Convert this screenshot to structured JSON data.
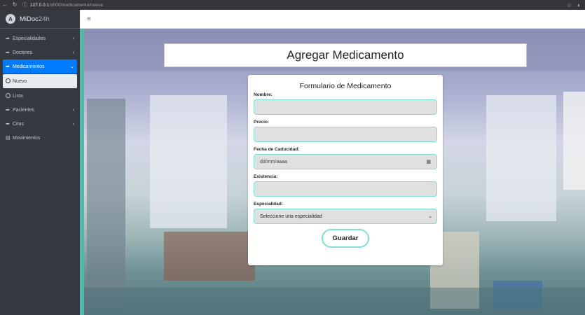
{
  "browser": {
    "url_host": "127.0.0.1",
    "url_path": ":8000/medicamento/nueva"
  },
  "sidebar": {
    "brand": {
      "part1": "MiDoc",
      "part2": "24h"
    },
    "items": [
      {
        "label": "Especialidades",
        "icon": "share-icon"
      },
      {
        "label": "Doctores",
        "icon": "share-icon"
      },
      {
        "label": "Medicamentos",
        "icon": "share-icon"
      },
      {
        "label": "Nuevo",
        "icon": "circle-icon"
      },
      {
        "label": "Lista",
        "icon": "circle-icon"
      },
      {
        "label": "Pacientes",
        "icon": "share-icon"
      },
      {
        "label": "Citas",
        "icon": "share-icon"
      },
      {
        "label": "Movimientos",
        "icon": "document-icon"
      }
    ]
  },
  "main": {
    "title": "Agregar Medicamento",
    "form": {
      "title": "Formulario de Medicamento",
      "fields": [
        {
          "label": "Nombre:",
          "value": ""
        },
        {
          "label": "Precio:",
          "value": ""
        },
        {
          "label": "Fecha de Caducidad:",
          "placeholder": "dd/mm/aaaa"
        },
        {
          "label": "Existencia:",
          "value": ""
        },
        {
          "label": "Especialidad:",
          "selected": "Seleccione una especialidad"
        }
      ],
      "submit_label": "Guardar"
    }
  },
  "colors": {
    "sidebar_bg": "#343a40",
    "active_item": "#007bff",
    "input_border": "#7fdfd3",
    "input_bg": "#e0e0e0"
  }
}
